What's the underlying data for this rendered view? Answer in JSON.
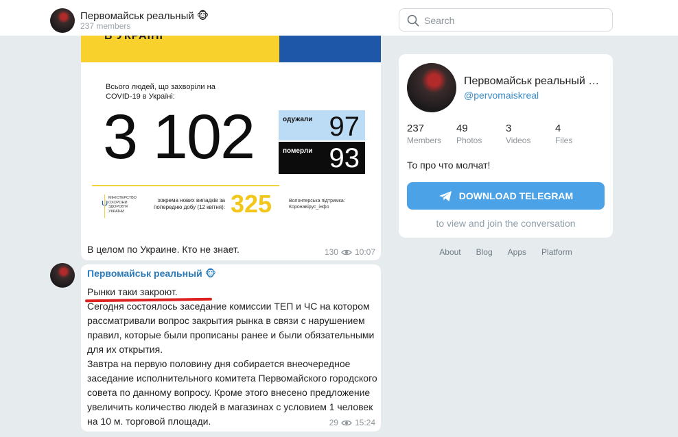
{
  "header": {
    "channel_title": "Первомайськ реальный 🐵",
    "members": "237 members",
    "search_placeholder": "Search"
  },
  "messages": [
    {
      "infographic": {
        "flag_word": "В УКРАЇНІ",
        "caption": "Всього людей, що захворіли на COVID-19 в Україні:",
        "total": "3 102",
        "recovered_label": "одужали",
        "recovered_value": "97",
        "died_label": "померли",
        "died_value": "93",
        "ministry": "МІНІСТЕРСТВО ОХОРОНИ ЗДОРОВ'Я УКРАЇНИ",
        "new_cases_label": "зокрема нових випадків за попередню добу (12 квітня):",
        "new_cases_value": "325",
        "volunteer": "Волонтерська підтримка: Коронавірус_інфо"
      },
      "text": "В целом по Украине. Кто не знает.",
      "views": "130",
      "time": "10:07"
    },
    {
      "sender": "Первомайськ реальный 🐵",
      "headline": "Рынки таки закроют.",
      "paragraphs": [
        "Сегодня состоялось заседание комиссии ТЕП и ЧС на котором рассматривали вопрос закрытия рынка в связи с нарушением правил, которые были прописаны ранее и были обязательными для их открытия.",
        "Завтра на первую половину дня собирается внеочередное заседание исполнительного комитета Первомайского городского совета по данному вопросу. Кроме этого внесено предложение увеличить количество людей в магазинах с условием 1 человек на 10 м. торговой площади."
      ],
      "views": "29",
      "time": "15:24"
    }
  ],
  "card": {
    "title": "Первомайськ реальный …",
    "handle": "@pervomaiskreal",
    "stats": [
      {
        "value": "237",
        "label": "Members"
      },
      {
        "value": "49",
        "label": "Photos"
      },
      {
        "value": "3",
        "label": "Videos"
      },
      {
        "value": "4",
        "label": "Files"
      }
    ],
    "description": "То про что молчат!",
    "download_label": "DOWNLOAD TELEGRAM",
    "join_text": "to view and join the conversation"
  },
  "footer": {
    "links": [
      "About",
      "Blog",
      "Apps",
      "Platform"
    ]
  },
  "colors": {
    "accent": "#4ca2e6",
    "link": "#3a8cc7",
    "background": "#e6ebee",
    "underline": "#dd2222"
  }
}
